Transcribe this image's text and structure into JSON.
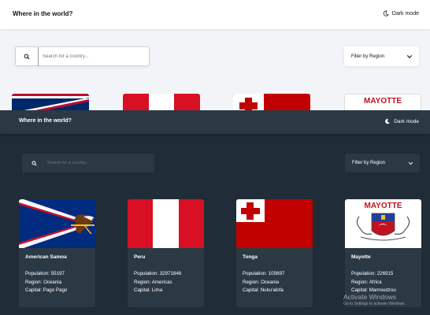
{
  "app_title": "Where in the world?",
  "theme_toggle_label": "Dark mode",
  "search_placeholder": "Search for a country...",
  "filter_label": "Filter by Region",
  "labels": {
    "population": "Population:",
    "region": "Region:",
    "capital": "Capital:"
  },
  "light_peek_banner": "MAYOTTE",
  "countries": [
    {
      "name": "American Samoa",
      "population": "55197",
      "region": "Oceania",
      "capital": "Pago Pago",
      "flag": "american-samoa"
    },
    {
      "name": "Peru",
      "population": "32971846",
      "region": "Americas",
      "capital": "Lima",
      "flag": "peru"
    },
    {
      "name": "Tonga",
      "population": "105697",
      "region": "Oceania",
      "capital": "Nuku'alofa",
      "flag": "tonga"
    },
    {
      "name": "Mayotte",
      "population": "226915",
      "region": "Africa",
      "capital": "Mamoudzou",
      "flag": "mayotte",
      "banner": "MAYOTTE"
    }
  ],
  "watermark": {
    "title": "Activate Windows",
    "subtitle": "Go to Settings to activate Windows."
  },
  "colors": {
    "dark_bg": "#202c37",
    "dark_element": "#2b3945",
    "light_bg": "#f2f4f7"
  }
}
